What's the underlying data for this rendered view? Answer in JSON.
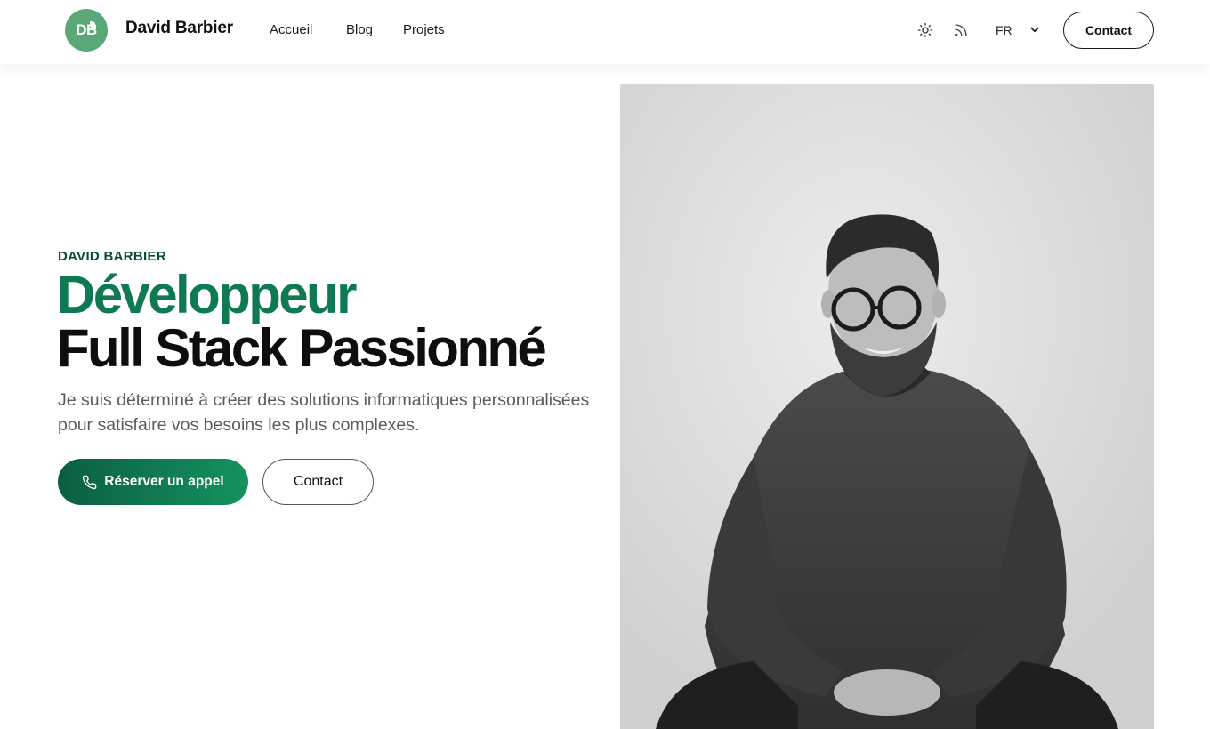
{
  "header": {
    "logo_text": "DB",
    "site_name": "David Barbier",
    "nav": [
      {
        "label": "Accueil"
      },
      {
        "label": "Blog"
      },
      {
        "label": "Projets"
      }
    ],
    "theme_icon": "sun-icon",
    "rss_icon": "rss-icon",
    "language": "FR",
    "language_chevron_icon": "chevron-down-icon",
    "contact_label": "Contact"
  },
  "hero": {
    "kicker": "DAVID BARBIER",
    "headline_line1": "Développeur",
    "headline_line2": "Full Stack Passionné",
    "intro": "Je suis déterminé à créer des solutions informatiques personnalisées pour satisfaire vos besoins les plus complexes.",
    "cta_primary": {
      "label": "Réserver un appel",
      "icon": "phone-icon"
    },
    "cta_secondary": {
      "label": "Contact"
    }
  },
  "colors": {
    "brand_green": "#0f7a52",
    "kicker_green": "#0d4a34",
    "logo_green": "#5aa877",
    "button_gradient_start": "#0b5e40",
    "button_gradient_end": "#14935f"
  }
}
